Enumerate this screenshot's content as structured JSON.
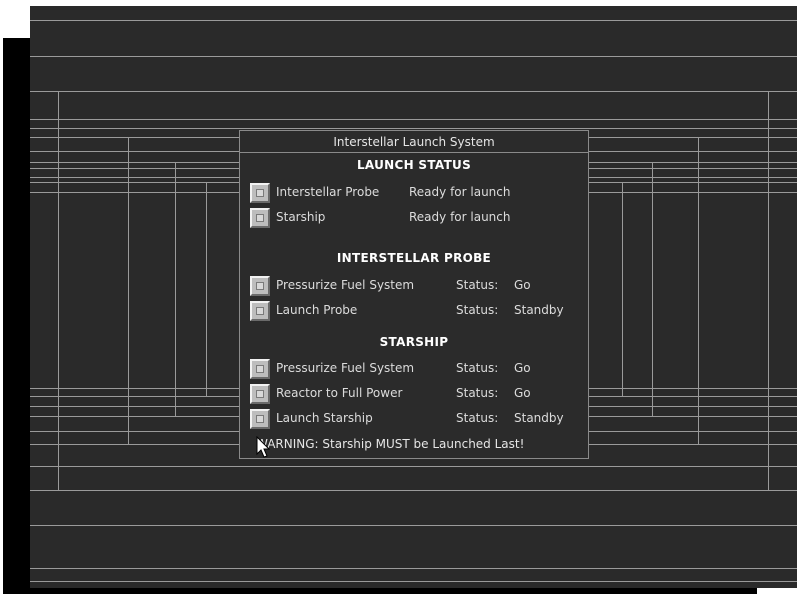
{
  "window": {
    "title": "Interstellar Launch System"
  },
  "launch_status": {
    "heading": "LAUNCH STATUS",
    "items": [
      {
        "label": "Interstellar Probe",
        "state": "Ready for launch"
      },
      {
        "label": "Starship",
        "state": "Ready for launch"
      }
    ]
  },
  "probe": {
    "heading": "INTERSTELLAR PROBE",
    "items": [
      {
        "label": "Pressurize Fuel System",
        "status_key": "Status:",
        "status": "Go"
      },
      {
        "label": "Launch Probe",
        "status_key": "Status:",
        "status": "Standby"
      }
    ]
  },
  "starship": {
    "heading": "STARSHIP",
    "items": [
      {
        "label": "Pressurize Fuel System",
        "status_key": "Status:",
        "status": "Go"
      },
      {
        "label": "Reactor to Full Power",
        "status_key": "Status:",
        "status": "Go"
      },
      {
        "label": "Launch Starship",
        "status_key": "Status:",
        "status": "Standby"
      }
    ]
  },
  "warning": "WARNING: Starship MUST be Launched Last!",
  "icons": {
    "checkbox": "square-checkbox-icon",
    "cursor": "arrow-cursor-icon"
  },
  "colors": {
    "background": "#2a2a2a",
    "panel": "#2b2b2b",
    "lines": "#9a9a9a",
    "text": "#dcdcdc"
  }
}
